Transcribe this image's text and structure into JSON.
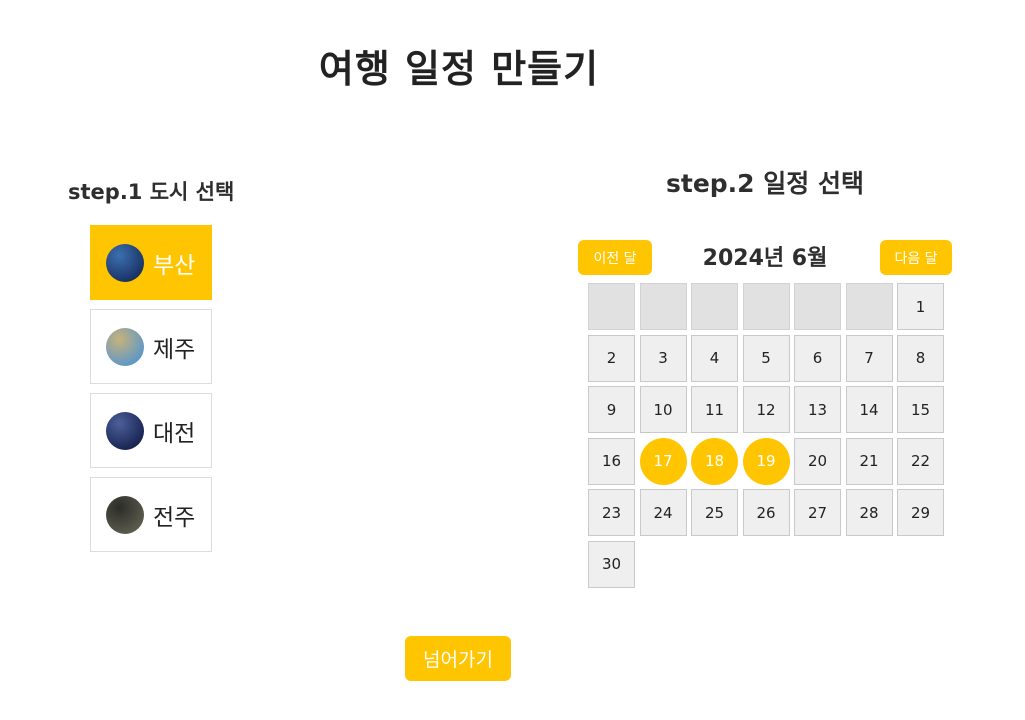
{
  "page": {
    "title": "여행 일정 만들기"
  },
  "step1": {
    "heading": "step.1 도시 선택",
    "cities": [
      {
        "name": "부산",
        "selected": true,
        "thumb_colors": [
          "#0c1e4a",
          "#3d6fb0"
        ]
      },
      {
        "name": "제주",
        "selected": false,
        "thumb_colors": [
          "#3a8fe0",
          "#c8b27a"
        ]
      },
      {
        "name": "대전",
        "selected": false,
        "thumb_colors": [
          "#06103a",
          "#4d5f9a"
        ]
      },
      {
        "name": "전주",
        "selected": false,
        "thumb_colors": [
          "#6b6a5a",
          "#2c2c28"
        ]
      }
    ]
  },
  "step2": {
    "heading": "step.2 일정 선택",
    "prev_label": "이전 달",
    "next_label": "다음 달",
    "month_title": "2024년 6월",
    "leading_blanks": 6,
    "days_in_month": 30,
    "selected_days": [
      17,
      18,
      19
    ]
  },
  "actions": {
    "next_label": "넘어가기"
  },
  "colors": {
    "accent": "#ffc500",
    "cell": "#efefef",
    "empty_cell": "#e1e1e1"
  }
}
